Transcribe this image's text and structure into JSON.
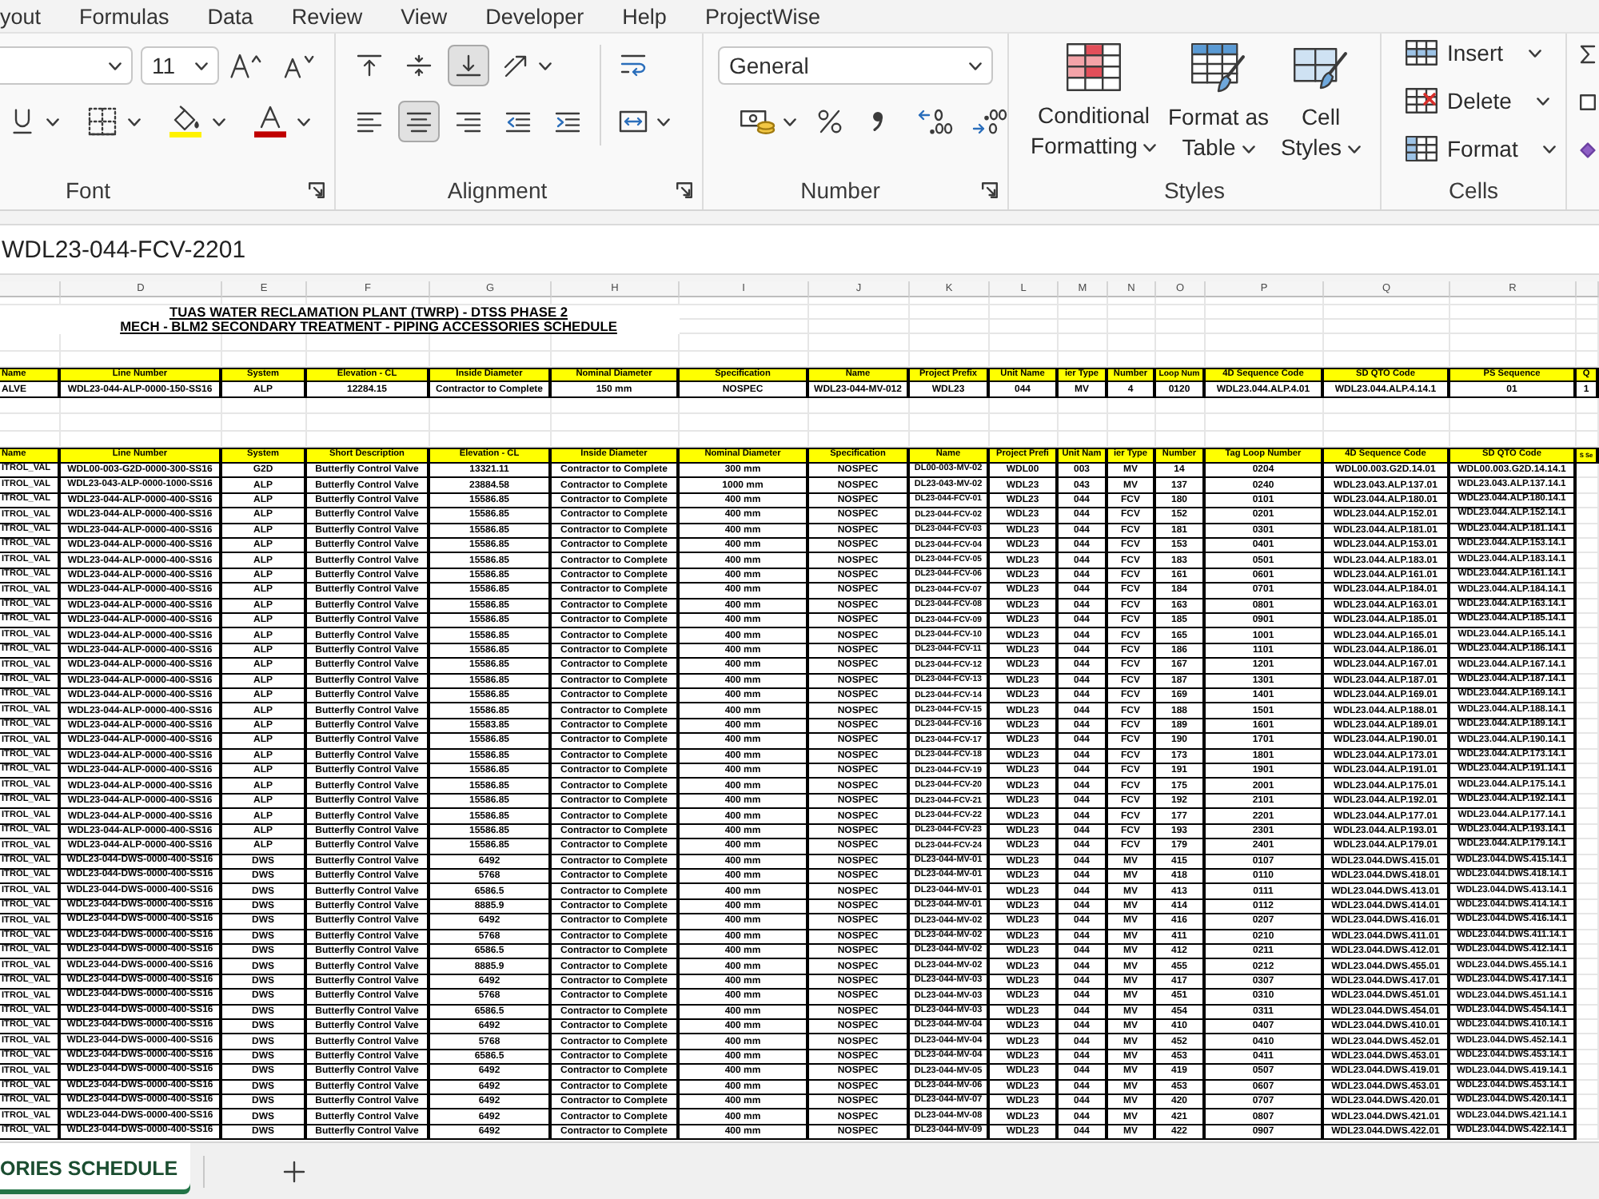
{
  "menu_tabs": [
    "yout",
    "Formulas",
    "Data",
    "Review",
    "View",
    "Developer",
    "Help",
    "ProjectWise"
  ],
  "ribbon": {
    "font": {
      "label": "Font",
      "size": "11"
    },
    "alignment": {
      "label": "Alignment",
      "rows": [
        [
          {
            "kind": "align-top",
            "selected": false
          },
          {
            "kind": "align-middle",
            "selected": false
          },
          {
            "kind": "align-bottom",
            "selected": true
          },
          {
            "kind": "orientation",
            "selected": false
          },
          {
            "kind": "wrap-text",
            "selected": false
          }
        ],
        [
          {
            "kind": "align-left",
            "selected": false
          },
          {
            "kind": "align-center",
            "selected": true
          },
          {
            "kind": "align-right",
            "selected": false
          },
          {
            "kind": "decrease-indent",
            "selected": false
          },
          {
            "kind": "increase-indent",
            "selected": false
          },
          {
            "kind": "merge",
            "selected": false
          }
        ]
      ]
    },
    "number": {
      "label": "Number",
      "format": "General"
    },
    "styles": {
      "label": "Styles",
      "buttons": [
        {
          "kind": "conditional",
          "label": "Conditional Formatting"
        },
        {
          "kind": "table",
          "label": "Format as Table"
        },
        {
          "kind": "cell",
          "label": "Cell Styles"
        }
      ]
    },
    "cells": {
      "label": "Cells",
      "buttons": [
        {
          "kind": "insert",
          "label": "Insert"
        },
        {
          "kind": "delete",
          "label": "Delete"
        },
        {
          "kind": "format",
          "label": "Format"
        }
      ]
    }
  },
  "formula_bar": {
    "value": "WDL23-044-FCV-2201"
  },
  "sheet": {
    "column_letters": [
      "D",
      "E",
      "F",
      "G",
      "H",
      "I",
      "J",
      "K",
      "L",
      "M",
      "N",
      "O",
      "P",
      "Q",
      "R"
    ],
    "titles": [
      "TUAS WATER RECLAMATION PLANT (TWRP) - DTSS PHASE 2",
      "MECH - BLM2 SECONDARY TREATMENT - PIPING ACCESSORIES SCHEDULE"
    ],
    "upper_table": {
      "columns": [
        "Name",
        "Line Number",
        "System",
        "Elevation - CL",
        "Inside Diameter",
        "Nominal Diameter",
        "Specification",
        "Name",
        "Project Prefix",
        "Unit Name",
        "ier Type",
        "Number",
        "Loop Num",
        "4D Sequence Code",
        "SD QTO Code",
        "PS Sequence",
        "Q"
      ],
      "rows": [
        [
          "ALVE",
          "WDL23-044-ALP-0000-150-SS16",
          "ALP",
          "12284.15",
          "Contractor to Complete",
          "150 mm",
          "NOSPEC",
          "WDL23-044-MV-012",
          "WDL23",
          "044",
          "MV",
          "4",
          "0120",
          "WDL23.044.ALP.4.01",
          "WDL23.044.ALP.4.14.1",
          "01",
          "1"
        ]
      ]
    },
    "lower_table": {
      "columns": [
        "Name",
        "Line Number",
        "System",
        "Short Description",
        "Elevation - CL",
        "Inside Diameter",
        "Nominal Diameter",
        "Specification",
        "Name",
        "Project Prefi",
        "Unit Nam",
        "ier Type",
        "Number",
        "Tag Loop Number",
        "4D Sequence Code",
        "SD QTO Code",
        "S Se"
      ],
      "rows": [
        [
          "ITROL_VAL",
          "WDL00-003-G2D-0000-300-SS16",
          "G2D",
          "Butterfly Control Valve",
          "13321.11",
          "Contractor to Complete",
          "300 mm",
          "NOSPEC",
          "DL00-003-MV-02",
          "WDL00",
          "003",
          "MV",
          "14",
          "0204",
          "WDL00.003.G2D.14.01",
          "WDL00.003.G2D.14.14.1"
        ],
        [
          "ITROL_VAL",
          "WDL23-043-ALP-0000-1000-SS16",
          "ALP",
          "Butterfly Control Valve",
          "23884.58",
          "Contractor to Complete",
          "1000 mm",
          "NOSPEC",
          "DL23-043-MV-02",
          "WDL23",
          "043",
          "MV",
          "137",
          "0240",
          "WDL23.043.ALP.137.01",
          "WDL23.043.ALP.137.14.1"
        ],
        [
          "ITROL_VAL",
          "WDL23-044-ALP-0000-400-SS16",
          "ALP",
          "Butterfly Control Valve",
          "15586.85",
          "Contractor to Complete",
          "400 mm",
          "NOSPEC",
          "DL23-044-FCV-01",
          "WDL23",
          "044",
          "FCV",
          "180",
          "0101",
          "WDL23.044.ALP.180.01",
          "WDL23.044.ALP.180.14.1"
        ],
        [
          "ITROL_VAL",
          "WDL23-044-ALP-0000-400-SS16",
          "ALP",
          "Butterfly Control Valve",
          "15586.85",
          "Contractor to Complete",
          "400 mm",
          "NOSPEC",
          "DL23-044-FCV-02",
          "WDL23",
          "044",
          "FCV",
          "152",
          "0201",
          "WDL23.044.ALP.152.01",
          "WDL23.044.ALP.152.14.1"
        ],
        [
          "ITROL_VAL",
          "WDL23-044-ALP-0000-400-SS16",
          "ALP",
          "Butterfly Control Valve",
          "15586.85",
          "Contractor to Complete",
          "400 mm",
          "NOSPEC",
          "DL23-044-FCV-03",
          "WDL23",
          "044",
          "FCV",
          "181",
          "0301",
          "WDL23.044.ALP.181.01",
          "WDL23.044.ALP.181.14.1"
        ],
        [
          "ITROL_VAL",
          "WDL23-044-ALP-0000-400-SS16",
          "ALP",
          "Butterfly Control Valve",
          "15586.85",
          "Contractor to Complete",
          "400 mm",
          "NOSPEC",
          "DL23-044-FCV-04",
          "WDL23",
          "044",
          "FCV",
          "153",
          "0401",
          "WDL23.044.ALP.153.01",
          "WDL23.044.ALP.153.14.1"
        ],
        [
          "ITROL_VAL",
          "WDL23-044-ALP-0000-400-SS16",
          "ALP",
          "Butterfly Control Valve",
          "15586.85",
          "Contractor to Complete",
          "400 mm",
          "NOSPEC",
          "DL23-044-FCV-05",
          "WDL23",
          "044",
          "FCV",
          "183",
          "0501",
          "WDL23.044.ALP.183.01",
          "WDL23.044.ALP.183.14.1"
        ],
        [
          "ITROL_VAL",
          "WDL23-044-ALP-0000-400-SS16",
          "ALP",
          "Butterfly Control Valve",
          "15586.85",
          "Contractor to Complete",
          "400 mm",
          "NOSPEC",
          "DL23-044-FCV-06",
          "WDL23",
          "044",
          "FCV",
          "161",
          "0601",
          "WDL23.044.ALP.161.01",
          "WDL23.044.ALP.161.14.1"
        ],
        [
          "ITROL_VAL",
          "WDL23-044-ALP-0000-400-SS16",
          "ALP",
          "Butterfly Control Valve",
          "15586.85",
          "Contractor to Complete",
          "400 mm",
          "NOSPEC",
          "DL23-044-FCV-07",
          "WDL23",
          "044",
          "FCV",
          "184",
          "0701",
          "WDL23.044.ALP.184.01",
          "WDL23.044.ALP.184.14.1"
        ],
        [
          "ITROL_VAL",
          "WDL23-044-ALP-0000-400-SS16",
          "ALP",
          "Butterfly Control Valve",
          "15586.85",
          "Contractor to Complete",
          "400 mm",
          "NOSPEC",
          "DL23-044-FCV-08",
          "WDL23",
          "044",
          "FCV",
          "163",
          "0801",
          "WDL23.044.ALP.163.01",
          "WDL23.044.ALP.163.14.1"
        ],
        [
          "ITROL_VAL",
          "WDL23-044-ALP-0000-400-SS16",
          "ALP",
          "Butterfly Control Valve",
          "15586.85",
          "Contractor to Complete",
          "400 mm",
          "NOSPEC",
          "DL23-044-FCV-09",
          "WDL23",
          "044",
          "FCV",
          "185",
          "0901",
          "WDL23.044.ALP.185.01",
          "WDL23.044.ALP.185.14.1"
        ],
        [
          "ITROL_VAL",
          "WDL23-044-ALP-0000-400-SS16",
          "ALP",
          "Butterfly Control Valve",
          "15586.85",
          "Contractor to Complete",
          "400 mm",
          "NOSPEC",
          "DL23-044-FCV-10",
          "WDL23",
          "044",
          "FCV",
          "165",
          "1001",
          "WDL23.044.ALP.165.01",
          "WDL23.044.ALP.165.14.1"
        ],
        [
          "ITROL_VAL",
          "WDL23-044-ALP-0000-400-SS16",
          "ALP",
          "Butterfly Control Valve",
          "15586.85",
          "Contractor to Complete",
          "400 mm",
          "NOSPEC",
          "DL23-044-FCV-11",
          "WDL23",
          "044",
          "FCV",
          "186",
          "1101",
          "WDL23.044.ALP.186.01",
          "WDL23.044.ALP.186.14.1"
        ],
        [
          "ITROL_VAL",
          "WDL23-044-ALP-0000-400-SS16",
          "ALP",
          "Butterfly Control Valve",
          "15586.85",
          "Contractor to Complete",
          "400 mm",
          "NOSPEC",
          "DL23-044-FCV-12",
          "WDL23",
          "044",
          "FCV",
          "167",
          "1201",
          "WDL23.044.ALP.167.01",
          "WDL23.044.ALP.167.14.1"
        ],
        [
          "ITROL_VAL",
          "WDL23-044-ALP-0000-400-SS16",
          "ALP",
          "Butterfly Control Valve",
          "15586.85",
          "Contractor to Complete",
          "400 mm",
          "NOSPEC",
          "DL23-044-FCV-13",
          "WDL23",
          "044",
          "FCV",
          "187",
          "1301",
          "WDL23.044.ALP.187.01",
          "WDL23.044.ALP.187.14.1"
        ],
        [
          "ITROL_VAL",
          "WDL23-044-ALP-0000-400-SS16",
          "ALP",
          "Butterfly Control Valve",
          "15586.85",
          "Contractor to Complete",
          "400 mm",
          "NOSPEC",
          "DL23-044-FCV-14",
          "WDL23",
          "044",
          "FCV",
          "169",
          "1401",
          "WDL23.044.ALP.169.01",
          "WDL23.044.ALP.169.14.1"
        ],
        [
          "ITROL_VAL",
          "WDL23-044-ALP-0000-400-SS16",
          "ALP",
          "Butterfly Control Valve",
          "15586.85",
          "Contractor to Complete",
          "400 mm",
          "NOSPEC",
          "DL23-044-FCV-15",
          "WDL23",
          "044",
          "FCV",
          "188",
          "1501",
          "WDL23.044.ALP.188.01",
          "WDL23.044.ALP.188.14.1"
        ],
        [
          "ITROL_VAL",
          "WDL23-044-ALP-0000-400-SS16",
          "ALP",
          "Butterfly Control Valve",
          "15583.85",
          "Contractor to Complete",
          "400 mm",
          "NOSPEC",
          "DL23-044-FCV-16",
          "WDL23",
          "044",
          "FCV",
          "189",
          "1601",
          "WDL23.044.ALP.189.01",
          "WDL23.044.ALP.189.14.1"
        ],
        [
          "ITROL_VAL",
          "WDL23-044-ALP-0000-400-SS16",
          "ALP",
          "Butterfly Control Valve",
          "15586.85",
          "Contractor to Complete",
          "400 mm",
          "NOSPEC",
          "DL23-044-FCV-17",
          "WDL23",
          "044",
          "FCV",
          "190",
          "1701",
          "WDL23.044.ALP.190.01",
          "WDL23.044.ALP.190.14.1"
        ],
        [
          "ITROL_VAL",
          "WDL23-044-ALP-0000-400-SS16",
          "ALP",
          "Butterfly Control Valve",
          "15586.85",
          "Contractor to Complete",
          "400 mm",
          "NOSPEC",
          "DL23-044-FCV-18",
          "WDL23",
          "044",
          "FCV",
          "173",
          "1801",
          "WDL23.044.ALP.173.01",
          "WDL23.044.ALP.173.14.1"
        ],
        [
          "ITROL_VAL",
          "WDL23-044-ALP-0000-400-SS16",
          "ALP",
          "Butterfly Control Valve",
          "15586.85",
          "Contractor to Complete",
          "400 mm",
          "NOSPEC",
          "DL23-044-FCV-19",
          "WDL23",
          "044",
          "FCV",
          "191",
          "1901",
          "WDL23.044.ALP.191.01",
          "WDL23.044.ALP.191.14.1"
        ],
        [
          "ITROL_VAL",
          "WDL23-044-ALP-0000-400-SS16",
          "ALP",
          "Butterfly Control Valve",
          "15586.85",
          "Contractor to Complete",
          "400 mm",
          "NOSPEC",
          "DL23-044-FCV-20",
          "WDL23",
          "044",
          "FCV",
          "175",
          "2001",
          "WDL23.044.ALP.175.01",
          "WDL23.044.ALP.175.14.1"
        ],
        [
          "ITROL_VAL",
          "WDL23-044-ALP-0000-400-SS16",
          "ALP",
          "Butterfly Control Valve",
          "15586.85",
          "Contractor to Complete",
          "400 mm",
          "NOSPEC",
          "DL23-044-FCV-21",
          "WDL23",
          "044",
          "FCV",
          "192",
          "2101",
          "WDL23.044.ALP.192.01",
          "WDL23.044.ALP.192.14.1"
        ],
        [
          "ITROL_VAL",
          "WDL23-044-ALP-0000-400-SS16",
          "ALP",
          "Butterfly Control Valve",
          "15586.85",
          "Contractor to Complete",
          "400 mm",
          "NOSPEC",
          "DL23-044-FCV-22",
          "WDL23",
          "044",
          "FCV",
          "177",
          "2201",
          "WDL23.044.ALP.177.01",
          "WDL23.044.ALP.177.14.1"
        ],
        [
          "ITROL_VAL",
          "WDL23-044-ALP-0000-400-SS16",
          "ALP",
          "Butterfly Control Valve",
          "15586.85",
          "Contractor to Complete",
          "400 mm",
          "NOSPEC",
          "DL23-044-FCV-23",
          "WDL23",
          "044",
          "FCV",
          "193",
          "2301",
          "WDL23.044.ALP.193.01",
          "WDL23.044.ALP.193.14.1"
        ],
        [
          "ITROL_VAL",
          "WDL23-044-ALP-0000-400-SS16",
          "ALP",
          "Butterfly Control Valve",
          "15586.85",
          "Contractor to Complete",
          "400 mm",
          "NOSPEC",
          "DL23-044-FCV-24",
          "WDL23",
          "044",
          "FCV",
          "179",
          "2401",
          "WDL23.044.ALP.179.01",
          "WDL23.044.ALP.179.14.1"
        ],
        [
          "ITROL_VAL",
          "WDL23-044-DWS-0000-400-SS16",
          "DWS",
          "Butterfly Control Valve",
          "6492",
          "Contractor to Complete",
          "400 mm",
          "NOSPEC",
          "DL23-044-MV-01",
          "WDL23",
          "044",
          "MV",
          "415",
          "0107",
          "WDL23.044.DWS.415.01",
          "WDL23.044.DWS.415.14.1"
        ],
        [
          "ITROL_VAL",
          "WDL23-044-DWS-0000-400-SS16",
          "DWS",
          "Butterfly Control Valve",
          "5768",
          "Contractor to Complete",
          "400 mm",
          "NOSPEC",
          "DL23-044-MV-01",
          "WDL23",
          "044",
          "MV",
          "418",
          "0110",
          "WDL23.044.DWS.418.01",
          "WDL23.044.DWS.418.14.1"
        ],
        [
          "ITROL_VAL",
          "WDL23-044-DWS-0000-400-SS16",
          "DWS",
          "Butterfly Control Valve",
          "6586.5",
          "Contractor to Complete",
          "400 mm",
          "NOSPEC",
          "DL23-044-MV-01",
          "WDL23",
          "044",
          "MV",
          "413",
          "0111",
          "WDL23.044.DWS.413.01",
          "WDL23.044.DWS.413.14.1"
        ],
        [
          "ITROL_VAL",
          "WDL23-044-DWS-0000-400-SS16",
          "DWS",
          "Butterfly Control Valve",
          "8885.9",
          "Contractor to Complete",
          "400 mm",
          "NOSPEC",
          "DL23-044-MV-01",
          "WDL23",
          "044",
          "MV",
          "414",
          "0112",
          "WDL23.044.DWS.414.01",
          "WDL23.044.DWS.414.14.1"
        ],
        [
          "ITROL_VAL",
          "WDL23-044-DWS-0000-400-SS16",
          "DWS",
          "Butterfly Control Valve",
          "6492",
          "Contractor to Complete",
          "400 mm",
          "NOSPEC",
          "DL23-044-MV-02",
          "WDL23",
          "044",
          "MV",
          "416",
          "0207",
          "WDL23.044.DWS.416.01",
          "WDL23.044.DWS.416.14.1"
        ],
        [
          "ITROL_VAL",
          "WDL23-044-DWS-0000-400-SS16",
          "DWS",
          "Butterfly Control Valve",
          "5768",
          "Contractor to Complete",
          "400 mm",
          "NOSPEC",
          "DL23-044-MV-02",
          "WDL23",
          "044",
          "MV",
          "411",
          "0210",
          "WDL23.044.DWS.411.01",
          "WDL23.044.DWS.411.14.1"
        ],
        [
          "ITROL_VAL",
          "WDL23-044-DWS-0000-400-SS16",
          "DWS",
          "Butterfly Control Valve",
          "6586.5",
          "Contractor to Complete",
          "400 mm",
          "NOSPEC",
          "DL23-044-MV-02",
          "WDL23",
          "044",
          "MV",
          "412",
          "0211",
          "WDL23.044.DWS.412.01",
          "WDL23.044.DWS.412.14.1"
        ],
        [
          "ITROL_VAL",
          "WDL23-044-DWS-0000-400-SS16",
          "DWS",
          "Butterfly Control Valve",
          "8885.9",
          "Contractor to Complete",
          "400 mm",
          "NOSPEC",
          "DL23-044-MV-02",
          "WDL23",
          "044",
          "MV",
          "455",
          "0212",
          "WDL23.044.DWS.455.01",
          "WDL23.044.DWS.455.14.1"
        ],
        [
          "ITROL_VAL",
          "WDL23-044-DWS-0000-400-SS16",
          "DWS",
          "Butterfly Control Valve",
          "6492",
          "Contractor to Complete",
          "400 mm",
          "NOSPEC",
          "DL23-044-MV-03",
          "WDL23",
          "044",
          "MV",
          "417",
          "0307",
          "WDL23.044.DWS.417.01",
          "WDL23.044.DWS.417.14.1"
        ],
        [
          "ITROL_VAL",
          "WDL23-044-DWS-0000-400-SS16",
          "DWS",
          "Butterfly Control Valve",
          "5768",
          "Contractor to Complete",
          "400 mm",
          "NOSPEC",
          "DL23-044-MV-03",
          "WDL23",
          "044",
          "MV",
          "451",
          "0310",
          "WDL23.044.DWS.451.01",
          "WDL23.044.DWS.451.14.1"
        ],
        [
          "ITROL_VAL",
          "WDL23-044-DWS-0000-400-SS16",
          "DWS",
          "Butterfly Control Valve",
          "6586.5",
          "Contractor to Complete",
          "400 mm",
          "NOSPEC",
          "DL23-044-MV-03",
          "WDL23",
          "044",
          "MV",
          "454",
          "0311",
          "WDL23.044.DWS.454.01",
          "WDL23.044.DWS.454.14.1"
        ],
        [
          "ITROL_VAL",
          "WDL23-044-DWS-0000-400-SS16",
          "DWS",
          "Butterfly Control Valve",
          "6492",
          "Contractor to Complete",
          "400 mm",
          "NOSPEC",
          "DL23-044-MV-04",
          "WDL23",
          "044",
          "MV",
          "410",
          "0407",
          "WDL23.044.DWS.410.01",
          "WDL23.044.DWS.410.14.1"
        ],
        [
          "ITROL_VAL",
          "WDL23-044-DWS-0000-400-SS16",
          "DWS",
          "Butterfly Control Valve",
          "5768",
          "Contractor to Complete",
          "400 mm",
          "NOSPEC",
          "DL23-044-MV-04",
          "WDL23",
          "044",
          "MV",
          "452",
          "0410",
          "WDL23.044.DWS.452.01",
          "WDL23.044.DWS.452.14.1"
        ],
        [
          "ITROL_VAL",
          "WDL23-044-DWS-0000-400-SS16",
          "DWS",
          "Butterfly Control Valve",
          "6586.5",
          "Contractor to Complete",
          "400 mm",
          "NOSPEC",
          "DL23-044-MV-04",
          "WDL23",
          "044",
          "MV",
          "453",
          "0411",
          "WDL23.044.DWS.453.01",
          "WDL23.044.DWS.453.14.1"
        ],
        [
          "ITROL_VAL",
          "WDL23-044-DWS-0000-400-SS16",
          "DWS",
          "Butterfly Control Valve",
          "6492",
          "Contractor to Complete",
          "400 mm",
          "NOSPEC",
          "DL23-044-MV-05",
          "WDL23",
          "044",
          "MV",
          "419",
          "0507",
          "WDL23.044.DWS.419.01",
          "WDL23.044.DWS.419.14.1"
        ],
        [
          "ITROL_VAL",
          "WDL23-044-DWS-0000-400-SS16",
          "DWS",
          "Butterfly Control Valve",
          "6492",
          "Contractor to Complete",
          "400 mm",
          "NOSPEC",
          "DL23-044-MV-06",
          "WDL23",
          "044",
          "MV",
          "453",
          "0607",
          "WDL23.044.DWS.453.01",
          "WDL23.044.DWS.453.14.1"
        ],
        [
          "ITROL_VAL",
          "WDL23-044-DWS-0000-400-SS16",
          "DWS",
          "Butterfly Control Valve",
          "6492",
          "Contractor to Complete",
          "400 mm",
          "NOSPEC",
          "DL23-044-MV-07",
          "WDL23",
          "044",
          "MV",
          "420",
          "0707",
          "WDL23.044.DWS.420.01",
          "WDL23.044.DWS.420.14.1"
        ],
        [
          "ITROL_VAL",
          "WDL23-044-DWS-0000-400-SS16",
          "DWS",
          "Butterfly Control Valve",
          "6492",
          "Contractor to Complete",
          "400 mm",
          "NOSPEC",
          "DL23-044-MV-08",
          "WDL23",
          "044",
          "MV",
          "421",
          "0807",
          "WDL23.044.DWS.421.01",
          "WDL23.044.DWS.421.14.1"
        ],
        [
          "ITROL_VAL",
          "WDL23-044-DWS-0000-400-SS16",
          "DWS",
          "Butterfly Control Valve",
          "6492",
          "Contractor to Complete",
          "400 mm",
          "NOSPEC",
          "DL23-044-MV-09",
          "WDL23",
          "044",
          "MV",
          "422",
          "0907",
          "WDL23.044.DWS.422.01",
          "WDL23.044.DWS.422.14.1"
        ]
      ]
    }
  },
  "sheet_tabs": [
    {
      "label": "ORIES SCHEDULE",
      "selected": true
    }
  ]
}
